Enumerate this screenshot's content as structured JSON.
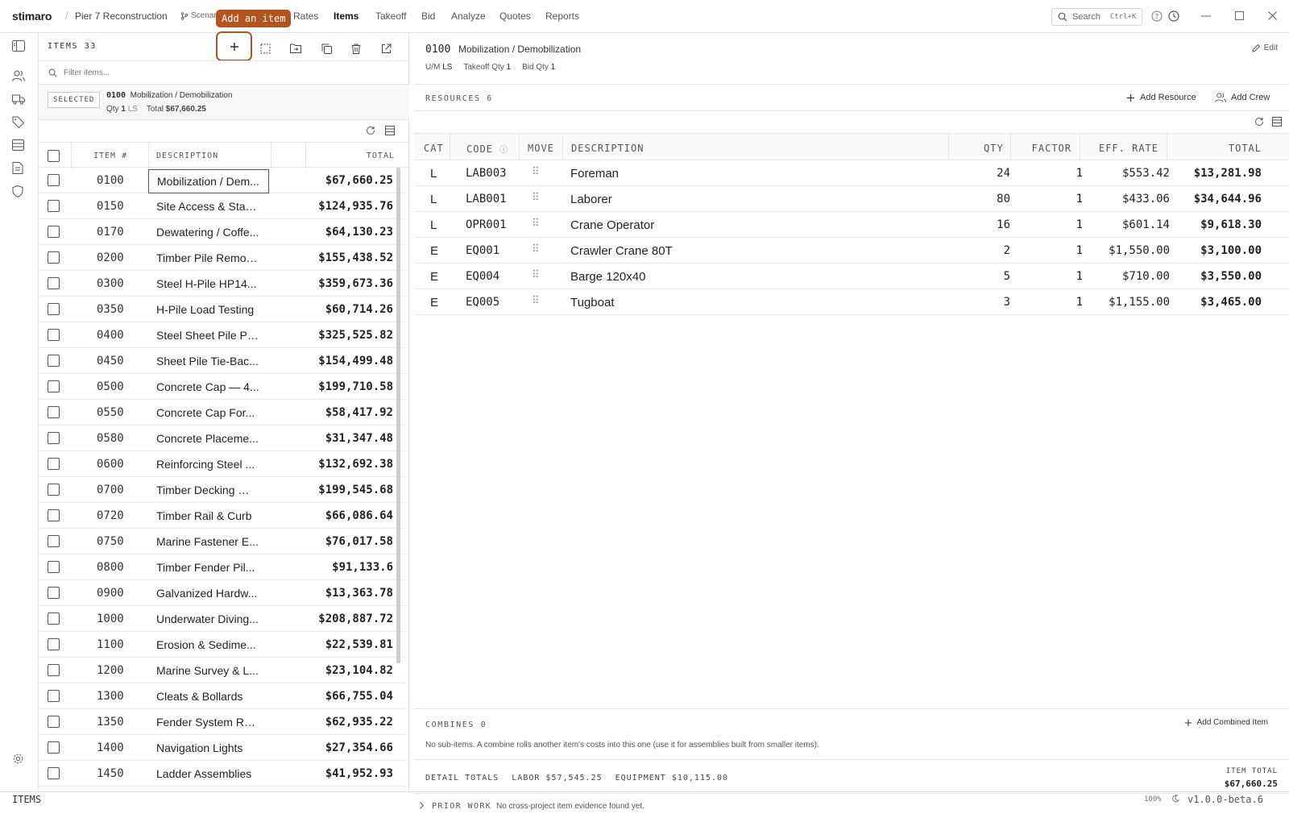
{
  "app": {
    "brand": "stimaro",
    "project": "Pier 7 Reconstruction",
    "scenario": "Scenar"
  },
  "nav": [
    "Rates",
    "Items",
    "Takeoff",
    "Bid",
    "Analyze",
    "Quotes",
    "Reports"
  ],
  "tooltip": "Add an item",
  "search": {
    "label": "Search",
    "shortcut": "Ctrl+K"
  },
  "items": {
    "header": "ITEMS 33",
    "filter_placeholder": "Filter items...",
    "selected": {
      "badge": "SELECTED",
      "code": "0100",
      "name": "Mobilization / Demobilization",
      "qty_label": "Qty",
      "qty": "1",
      "unit": "LS",
      "total_label": "Total",
      "total": "$67,660.25"
    },
    "columns": [
      "ITEM #",
      "DESCRIPTION",
      "TOTAL"
    ],
    "rows": [
      {
        "num": "0100",
        "desc": "Mobilization / Dem...",
        "total": "$67,660.25"
      },
      {
        "num": "0150",
        "desc": "Site Access & Stag...",
        "total": "$124,935.76"
      },
      {
        "num": "0170",
        "desc": "Dewatering / Coffe...",
        "total": "$64,130.23"
      },
      {
        "num": "0200",
        "desc": "Timber Pile Removal",
        "total": "$155,438.52"
      },
      {
        "num": "0300",
        "desc": "Steel H-Pile HP14...",
        "total": "$359,673.36"
      },
      {
        "num": "0350",
        "desc": "H-Pile Load Testing",
        "total": "$60,714.26"
      },
      {
        "num": "0400",
        "desc": "Steel Sheet Pile PZ...",
        "total": "$325,525.82"
      },
      {
        "num": "0450",
        "desc": "Sheet Pile Tie-Bac...",
        "total": "$154,499.48"
      },
      {
        "num": "0500",
        "desc": "Concrete Cap — 4...",
        "total": "$199,710.58"
      },
      {
        "num": "0550",
        "desc": "Concrete Cap For...",
        "total": "$58,417.92"
      },
      {
        "num": "0580",
        "desc": "Concrete Placeme...",
        "total": "$31,347.48"
      },
      {
        "num": "0600",
        "desc": "Reinforcing Steel ...",
        "total": "$132,692.38"
      },
      {
        "num": "0700",
        "desc": "Timber Decking — ...",
        "total": "$199,545.68"
      },
      {
        "num": "0720",
        "desc": "Timber Rail & Curb",
        "total": "$66,086.64"
      },
      {
        "num": "0750",
        "desc": "Marine Fastener E...",
        "total": "$76,017.58"
      },
      {
        "num": "0800",
        "desc": "Timber Fender Pil...",
        "total": "$91,133.6"
      },
      {
        "num": "0900",
        "desc": "Galvanized Hardw...",
        "total": "$13,363.78"
      },
      {
        "num": "1000",
        "desc": "Underwater Diving...",
        "total": "$208,887.72"
      },
      {
        "num": "1100",
        "desc": "Erosion & Sedime...",
        "total": "$22,539.81"
      },
      {
        "num": "1200",
        "desc": "Marine Survey & L...",
        "total": "$23,104.82"
      },
      {
        "num": "1300",
        "desc": "Cleats & Bollards",
        "total": "$66,755.04"
      },
      {
        "num": "1350",
        "desc": "Fender System Ru...",
        "total": "$62,935.22"
      },
      {
        "num": "1400",
        "desc": "Navigation Lights",
        "total": "$27,354.66"
      },
      {
        "num": "1450",
        "desc": "Ladder Assemblies",
        "total": "$41,952.93"
      }
    ]
  },
  "detail": {
    "code": "0100",
    "name": "Mobilization / Demobilization",
    "edit": "Edit",
    "meta": {
      "um_label": "U/M",
      "um": "LS",
      "takeoff_label": "Takeoff Qty",
      "takeoff": "1",
      "bid_label": "Bid Qty",
      "bid": "1"
    },
    "resources_title": "RESOURCES 6",
    "add_resource": "Add Resource",
    "add_crew": "Add Crew",
    "columns": [
      "CAT",
      "CODE",
      "MOVE",
      "DESCRIPTION",
      "QTY",
      "FACTOR",
      "EFF. RATE",
      "TOTAL"
    ],
    "rows": [
      {
        "cat": "L",
        "code": "LAB003",
        "desc": "Foreman",
        "qty": "24",
        "factor": "1",
        "rate": "$553.42",
        "total": "$13,281.98"
      },
      {
        "cat": "L",
        "code": "LAB001",
        "desc": "Laborer",
        "qty": "80",
        "factor": "1",
        "rate": "$433.06",
        "total": "$34,644.96"
      },
      {
        "cat": "L",
        "code": "OPR001",
        "desc": "Crane Operator",
        "qty": "16",
        "factor": "1",
        "rate": "$601.14",
        "total": "$9,618.30"
      },
      {
        "cat": "E",
        "code": "EQ001",
        "desc": "Crawler Crane 80T",
        "qty": "2",
        "factor": "1",
        "rate": "$1,550.00",
        "total": "$3,100.00"
      },
      {
        "cat": "E",
        "code": "EQ004",
        "desc": "Barge 120x40",
        "qty": "5",
        "factor": "1",
        "rate": "$710.00",
        "total": "$3,550.00"
      },
      {
        "cat": "E",
        "code": "EQ005",
        "desc": "Tugboat",
        "qty": "3",
        "factor": "1",
        "rate": "$1,155.00",
        "total": "$3,465.00"
      }
    ],
    "combines_title": "COMBINES 0",
    "add_combined": "Add Combined Item",
    "combines_note": "No sub-items. A combine rolls another item's costs into this one (use it for assemblies built from smaller items).",
    "totals": {
      "label": "DETAIL TOTALS",
      "labor": "LABOR $57,545.25",
      "equipment": "EQUIPMENT $10,115.00",
      "item_total_label": "ITEM TOTAL",
      "item_total": "$67,660.25"
    },
    "prior": {
      "label": "PRIOR WORK",
      "note": "No cross-project item evidence found yet."
    }
  },
  "status": {
    "left": "ITEMS",
    "zoom": "100%",
    "version": "v1.0.0-beta.6"
  },
  "colors": {
    "accent": "#b3541e"
  }
}
